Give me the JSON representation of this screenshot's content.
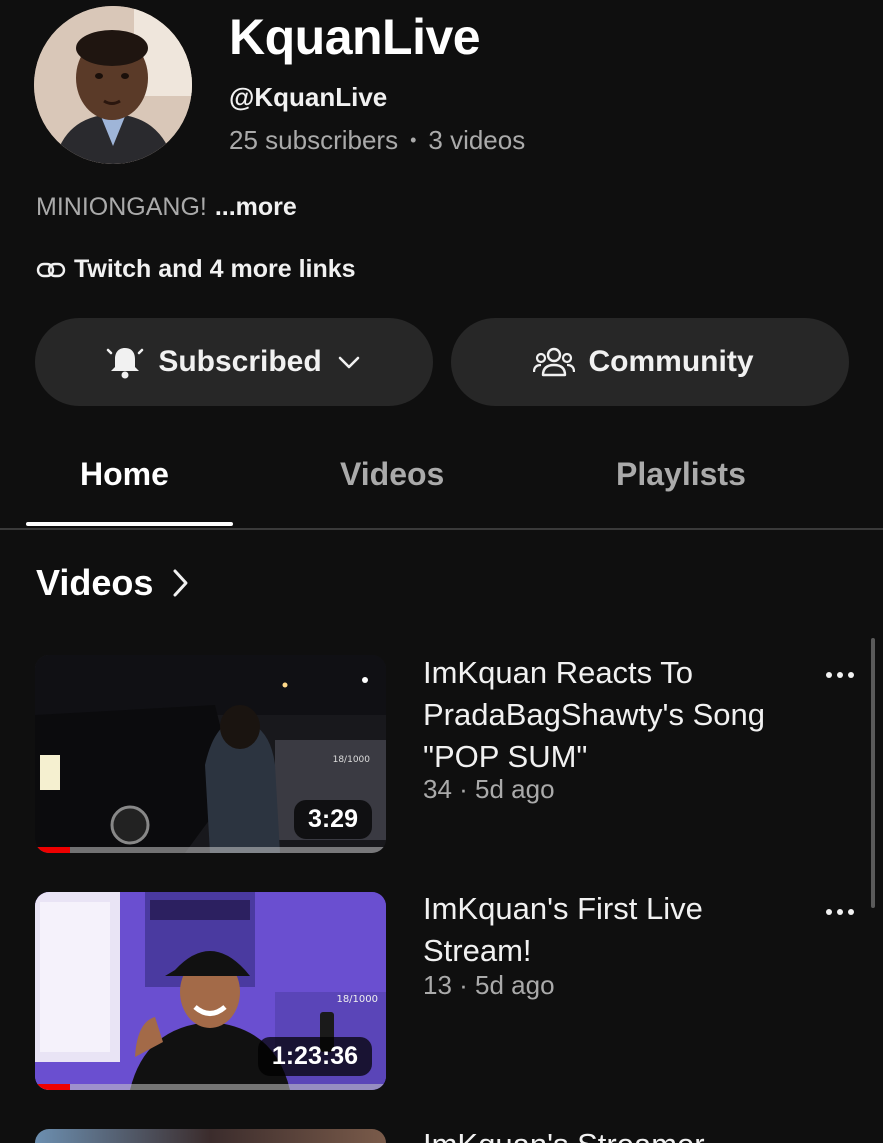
{
  "channel": {
    "name": "KquanLive",
    "handle": "@KquanLive",
    "subscribers": "25 subscribers",
    "separator": "•",
    "videos_count": "3 videos",
    "description": "MINIONGANG!",
    "more_label": "...more",
    "links_label": "Twitch and 4 more links"
  },
  "actions": {
    "subscribed_label": "Subscribed",
    "community_label": "Community"
  },
  "tabs": [
    {
      "label": "Home",
      "active": true
    },
    {
      "label": "Videos",
      "active": false
    },
    {
      "label": "Playlists",
      "active": false
    }
  ],
  "section": {
    "title": "Videos"
  },
  "videos": [
    {
      "title": "ImKquan Reacts To PradaBagShawty's Song \"POP SUM\"",
      "meta": "34 · 5d ago",
      "duration": "3:29",
      "progress": 0.1,
      "overlay_text": "18/1000"
    },
    {
      "title": "ImKquan's First Live Stream!",
      "meta": "13 · 5d ago",
      "duration": "1:23:36",
      "progress": 0.1,
      "overlay_text": "18/1000"
    },
    {
      "title": "ImKquan's Streamer"
    }
  ],
  "colors": {
    "background": "#0f0f0f",
    "button_bg": "#272727",
    "secondary_text": "#aaaaaa",
    "progress_red": "#ee0000"
  },
  "icons": {
    "link": "link-icon",
    "bell": "bell-icon",
    "chevron_down": "chevron-down-icon",
    "community": "people-icon",
    "chevron_right": "chevron-right-icon",
    "more": "more-vertical-icon"
  }
}
